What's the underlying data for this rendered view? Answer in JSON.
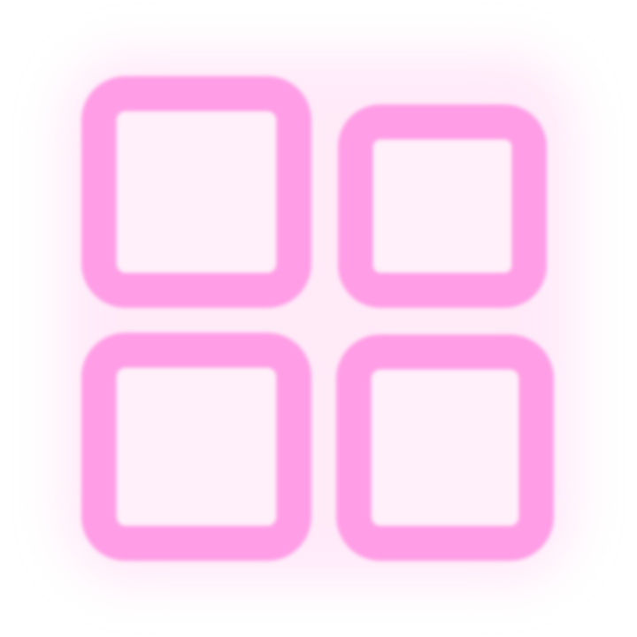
{
  "icon": {
    "name": "grid-view-icon",
    "stroke_color": "#ff9ee6",
    "fill_color": "#fff0fa",
    "glow_color": "#ffd9f4",
    "background_color": "#ffffff"
  }
}
